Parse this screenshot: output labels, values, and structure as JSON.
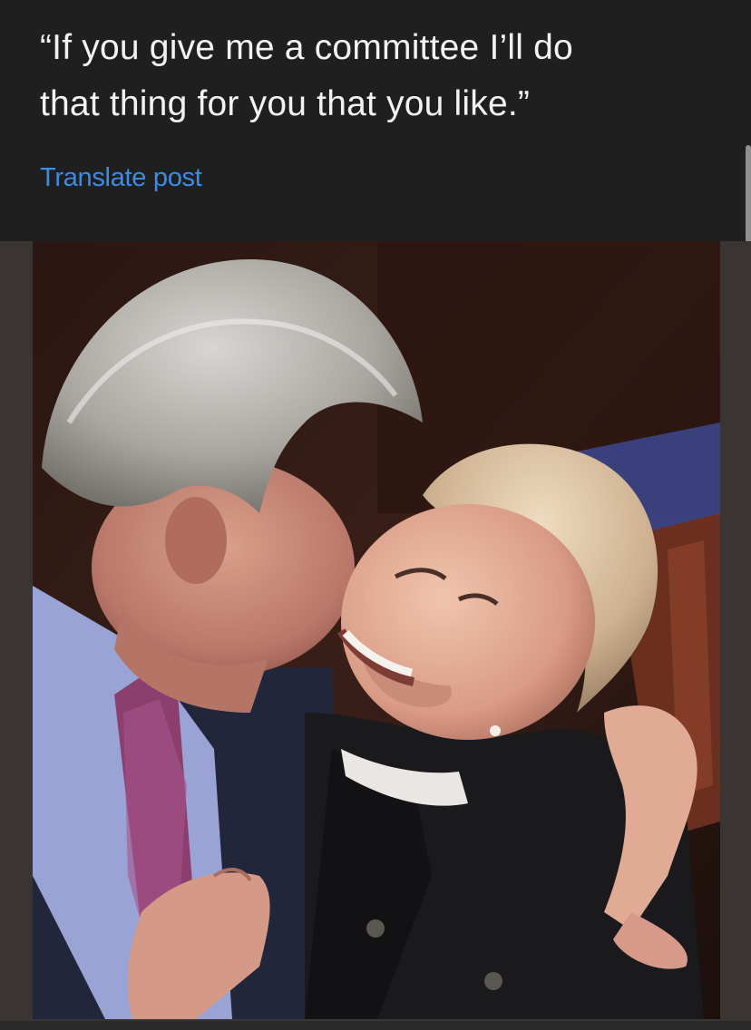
{
  "post": {
    "text": "“If you give me a committee I’ll do\nthat thing for you that you like.”",
    "translate_label": "Translate post"
  },
  "media": {
    "type": "photo",
    "subjects": [
      "man-in-suit",
      "woman-smiling"
    ]
  },
  "colors": {
    "background": "#1f1f1f",
    "text": "#f2f2f2",
    "link": "#3b8be8"
  }
}
